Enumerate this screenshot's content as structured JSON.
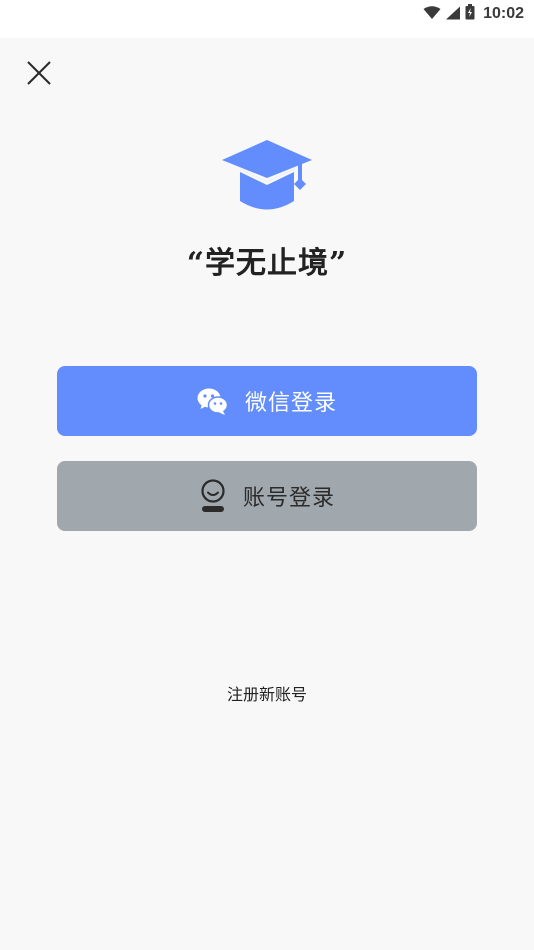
{
  "status_bar": {
    "time": "10:02",
    "icons": [
      "wifi-icon",
      "signal-icon",
      "battery-icon"
    ]
  },
  "header": {
    "close_icon": "close-icon"
  },
  "brand": {
    "logo_icon": "graduation-cap-icon",
    "slogan": "“学无止境”",
    "accent_color": "#638dfc"
  },
  "login": {
    "wechat": {
      "icon": "wechat-icon",
      "label": "微信登录",
      "color": "#638dfc"
    },
    "account": {
      "icon": "user-account-icon",
      "label": "账号登录",
      "color": "#a0a7ad"
    }
  },
  "register": {
    "label": "注册新账号"
  }
}
